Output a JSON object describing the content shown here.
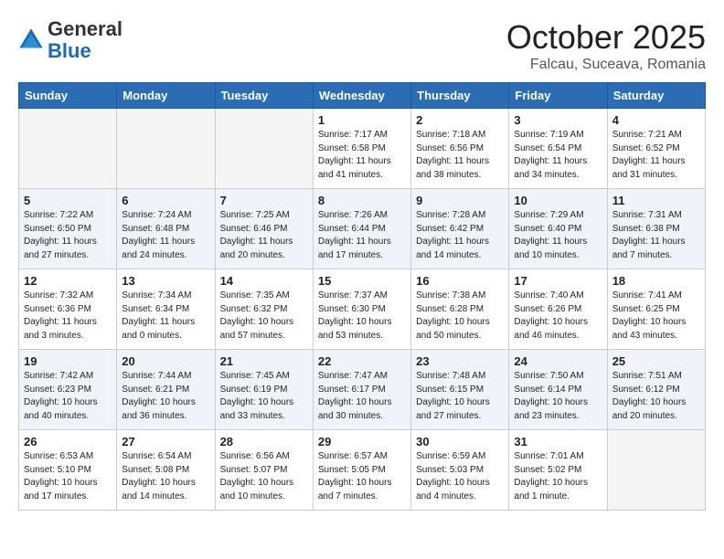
{
  "header": {
    "logo_general": "General",
    "logo_blue": "Blue",
    "title": "October 2025",
    "subtitle": "Falcau, Suceava, Romania"
  },
  "days_of_week": [
    "Sunday",
    "Monday",
    "Tuesday",
    "Wednesday",
    "Thursday",
    "Friday",
    "Saturday"
  ],
  "weeks": [
    [
      {
        "day": "",
        "info": ""
      },
      {
        "day": "",
        "info": ""
      },
      {
        "day": "",
        "info": ""
      },
      {
        "day": "1",
        "info": "Sunrise: 7:17 AM\nSunset: 6:58 PM\nDaylight: 11 hours\nand 41 minutes."
      },
      {
        "day": "2",
        "info": "Sunrise: 7:18 AM\nSunset: 6:56 PM\nDaylight: 11 hours\nand 38 minutes."
      },
      {
        "day": "3",
        "info": "Sunrise: 7:19 AM\nSunset: 6:54 PM\nDaylight: 11 hours\nand 34 minutes."
      },
      {
        "day": "4",
        "info": "Sunrise: 7:21 AM\nSunset: 6:52 PM\nDaylight: 11 hours\nand 31 minutes."
      }
    ],
    [
      {
        "day": "5",
        "info": "Sunrise: 7:22 AM\nSunset: 6:50 PM\nDaylight: 11 hours\nand 27 minutes."
      },
      {
        "day": "6",
        "info": "Sunrise: 7:24 AM\nSunset: 6:48 PM\nDaylight: 11 hours\nand 24 minutes."
      },
      {
        "day": "7",
        "info": "Sunrise: 7:25 AM\nSunset: 6:46 PM\nDaylight: 11 hours\nand 20 minutes."
      },
      {
        "day": "8",
        "info": "Sunrise: 7:26 AM\nSunset: 6:44 PM\nDaylight: 11 hours\nand 17 minutes."
      },
      {
        "day": "9",
        "info": "Sunrise: 7:28 AM\nSunset: 6:42 PM\nDaylight: 11 hours\nand 14 minutes."
      },
      {
        "day": "10",
        "info": "Sunrise: 7:29 AM\nSunset: 6:40 PM\nDaylight: 11 hours\nand 10 minutes."
      },
      {
        "day": "11",
        "info": "Sunrise: 7:31 AM\nSunset: 6:38 PM\nDaylight: 11 hours\nand 7 minutes."
      }
    ],
    [
      {
        "day": "12",
        "info": "Sunrise: 7:32 AM\nSunset: 6:36 PM\nDaylight: 11 hours\nand 3 minutes."
      },
      {
        "day": "13",
        "info": "Sunrise: 7:34 AM\nSunset: 6:34 PM\nDaylight: 11 hours\nand 0 minutes."
      },
      {
        "day": "14",
        "info": "Sunrise: 7:35 AM\nSunset: 6:32 PM\nDaylight: 10 hours\nand 57 minutes."
      },
      {
        "day": "15",
        "info": "Sunrise: 7:37 AM\nSunset: 6:30 PM\nDaylight: 10 hours\nand 53 minutes."
      },
      {
        "day": "16",
        "info": "Sunrise: 7:38 AM\nSunset: 6:28 PM\nDaylight: 10 hours\nand 50 minutes."
      },
      {
        "day": "17",
        "info": "Sunrise: 7:40 AM\nSunset: 6:26 PM\nDaylight: 10 hours\nand 46 minutes."
      },
      {
        "day": "18",
        "info": "Sunrise: 7:41 AM\nSunset: 6:25 PM\nDaylight: 10 hours\nand 43 minutes."
      }
    ],
    [
      {
        "day": "19",
        "info": "Sunrise: 7:42 AM\nSunset: 6:23 PM\nDaylight: 10 hours\nand 40 minutes."
      },
      {
        "day": "20",
        "info": "Sunrise: 7:44 AM\nSunset: 6:21 PM\nDaylight: 10 hours\nand 36 minutes."
      },
      {
        "day": "21",
        "info": "Sunrise: 7:45 AM\nSunset: 6:19 PM\nDaylight: 10 hours\nand 33 minutes."
      },
      {
        "day": "22",
        "info": "Sunrise: 7:47 AM\nSunset: 6:17 PM\nDaylight: 10 hours\nand 30 minutes."
      },
      {
        "day": "23",
        "info": "Sunrise: 7:48 AM\nSunset: 6:15 PM\nDaylight: 10 hours\nand 27 minutes."
      },
      {
        "day": "24",
        "info": "Sunrise: 7:50 AM\nSunset: 6:14 PM\nDaylight: 10 hours\nand 23 minutes."
      },
      {
        "day": "25",
        "info": "Sunrise: 7:51 AM\nSunset: 6:12 PM\nDaylight: 10 hours\nand 20 minutes."
      }
    ],
    [
      {
        "day": "26",
        "info": "Sunrise: 6:53 AM\nSunset: 5:10 PM\nDaylight: 10 hours\nand 17 minutes."
      },
      {
        "day": "27",
        "info": "Sunrise: 6:54 AM\nSunset: 5:08 PM\nDaylight: 10 hours\nand 14 minutes."
      },
      {
        "day": "28",
        "info": "Sunrise: 6:56 AM\nSunset: 5:07 PM\nDaylight: 10 hours\nand 10 minutes."
      },
      {
        "day": "29",
        "info": "Sunrise: 6:57 AM\nSunset: 5:05 PM\nDaylight: 10 hours\nand 7 minutes."
      },
      {
        "day": "30",
        "info": "Sunrise: 6:59 AM\nSunset: 5:03 PM\nDaylight: 10 hours\nand 4 minutes."
      },
      {
        "day": "31",
        "info": "Sunrise: 7:01 AM\nSunset: 5:02 PM\nDaylight: 10 hours\nand 1 minute."
      },
      {
        "day": "",
        "info": ""
      }
    ]
  ]
}
